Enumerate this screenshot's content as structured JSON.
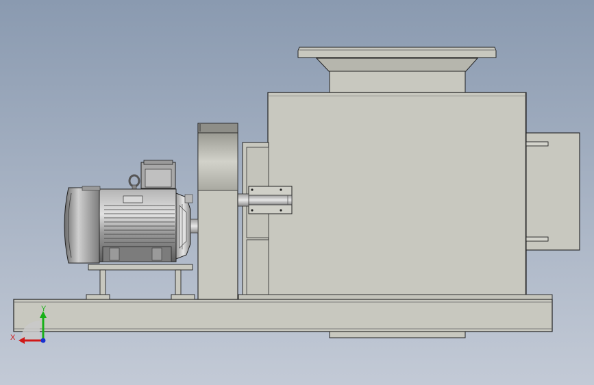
{
  "viewport": {
    "background_top": "#8a9ab0",
    "background_bottom": "#c3cad6"
  },
  "model": {
    "part_fill": "#c8c8bf",
    "edge_color": "#222222",
    "motor_fill": "#8e8e8e"
  },
  "triad": {
    "x_label": "X",
    "y_label": "Y",
    "x_color": "#d01818",
    "y_color": "#18b018",
    "z_color": "#1830d0"
  }
}
